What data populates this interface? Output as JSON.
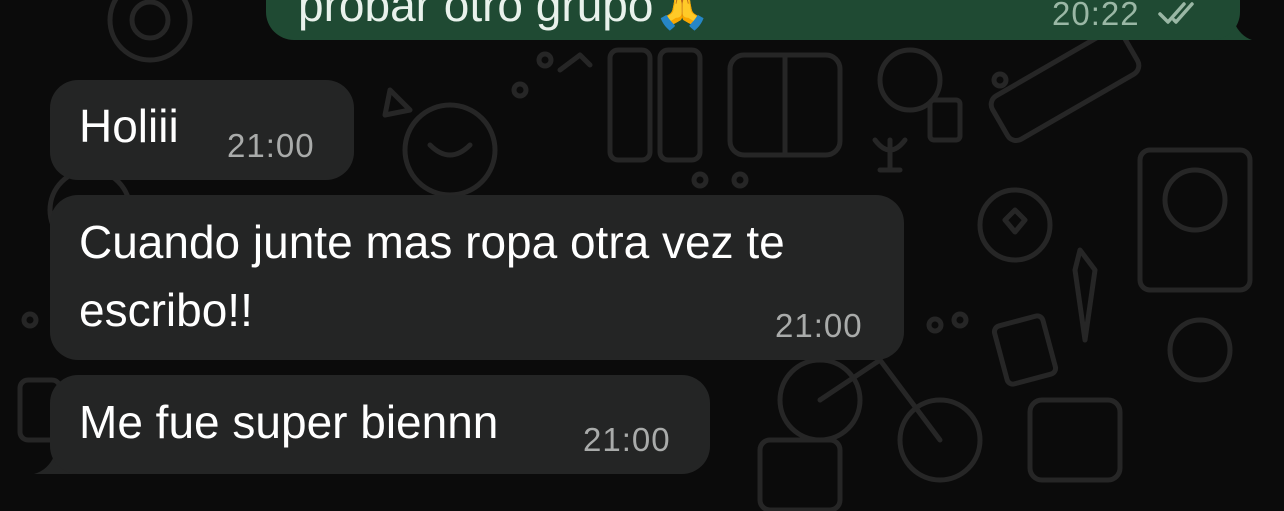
{
  "chat": {
    "messages": [
      {
        "direction": "outgoing",
        "text": "probar otro grupo🙏",
        "time": "20:22",
        "status": "read",
        "status_icon": "double-check-icon"
      },
      {
        "direction": "incoming",
        "text": "Holiii",
        "time": "21:00"
      },
      {
        "direction": "incoming",
        "lines": [
          "Cuando junte mas ropa otra vez te",
          "escribo!!"
        ],
        "time": "21:00"
      },
      {
        "direction": "incoming",
        "text": "Me fue super biennn",
        "time": "21:00"
      }
    ]
  },
  "theme": {
    "background": "#0b0b0b",
    "incoming_bubble": "#242525",
    "outgoing_bubble": "#1f4a33",
    "wallpaper_doodle": "#262626",
    "message_text": "#ffffff",
    "time_text": "#a9abaa"
  }
}
